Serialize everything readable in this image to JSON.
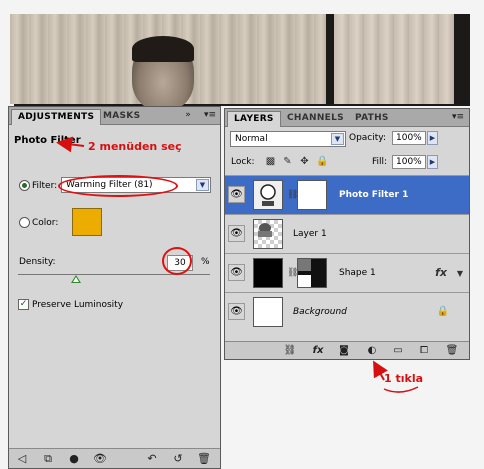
{
  "adjustments": {
    "tabs": [
      "ADJUSTMENTS",
      "MASKS"
    ],
    "collapse_icon": "»",
    "title": "Photo Filter",
    "filter_label": "Filter:",
    "filter_value": "Warming Filter (81)",
    "color_label": "Color:",
    "color_swatch": "#ecac00",
    "density_label": "Density:",
    "density_value": "30",
    "density_unit": "%",
    "preserve_label": "Preserve Luminosity",
    "preserve_checked": true,
    "filter_selected": true
  },
  "layers": {
    "tabs": [
      "LAYERS",
      "CHANNELS",
      "PATHS"
    ],
    "blend_mode": "Normal",
    "opacity_label": "Opacity:",
    "opacity_value": "100%",
    "lock_label": "Lock:",
    "fill_label": "Fill:",
    "fill_value": "100%",
    "items": [
      {
        "name": "Photo Filter 1",
        "selected": true
      },
      {
        "name": "Layer 1",
        "selected": false
      },
      {
        "name": "Shape 1",
        "fx": "fx",
        "selected": false
      },
      {
        "name": "Background",
        "locked": true,
        "selected": false
      }
    ]
  },
  "annotations": {
    "menu_hint": "2 menüden seç",
    "click_hint": "1 tıkla"
  },
  "colors": {
    "selection": "#3d6cc6",
    "annotation": "#d61010",
    "panel": "#d6d6d6"
  },
  "icons": {
    "eye": "eye-icon",
    "link": "chain-link-icon",
    "fx": "fx-icon",
    "lock": "lock-icon",
    "new_adjustment": "half-circle-icon"
  }
}
